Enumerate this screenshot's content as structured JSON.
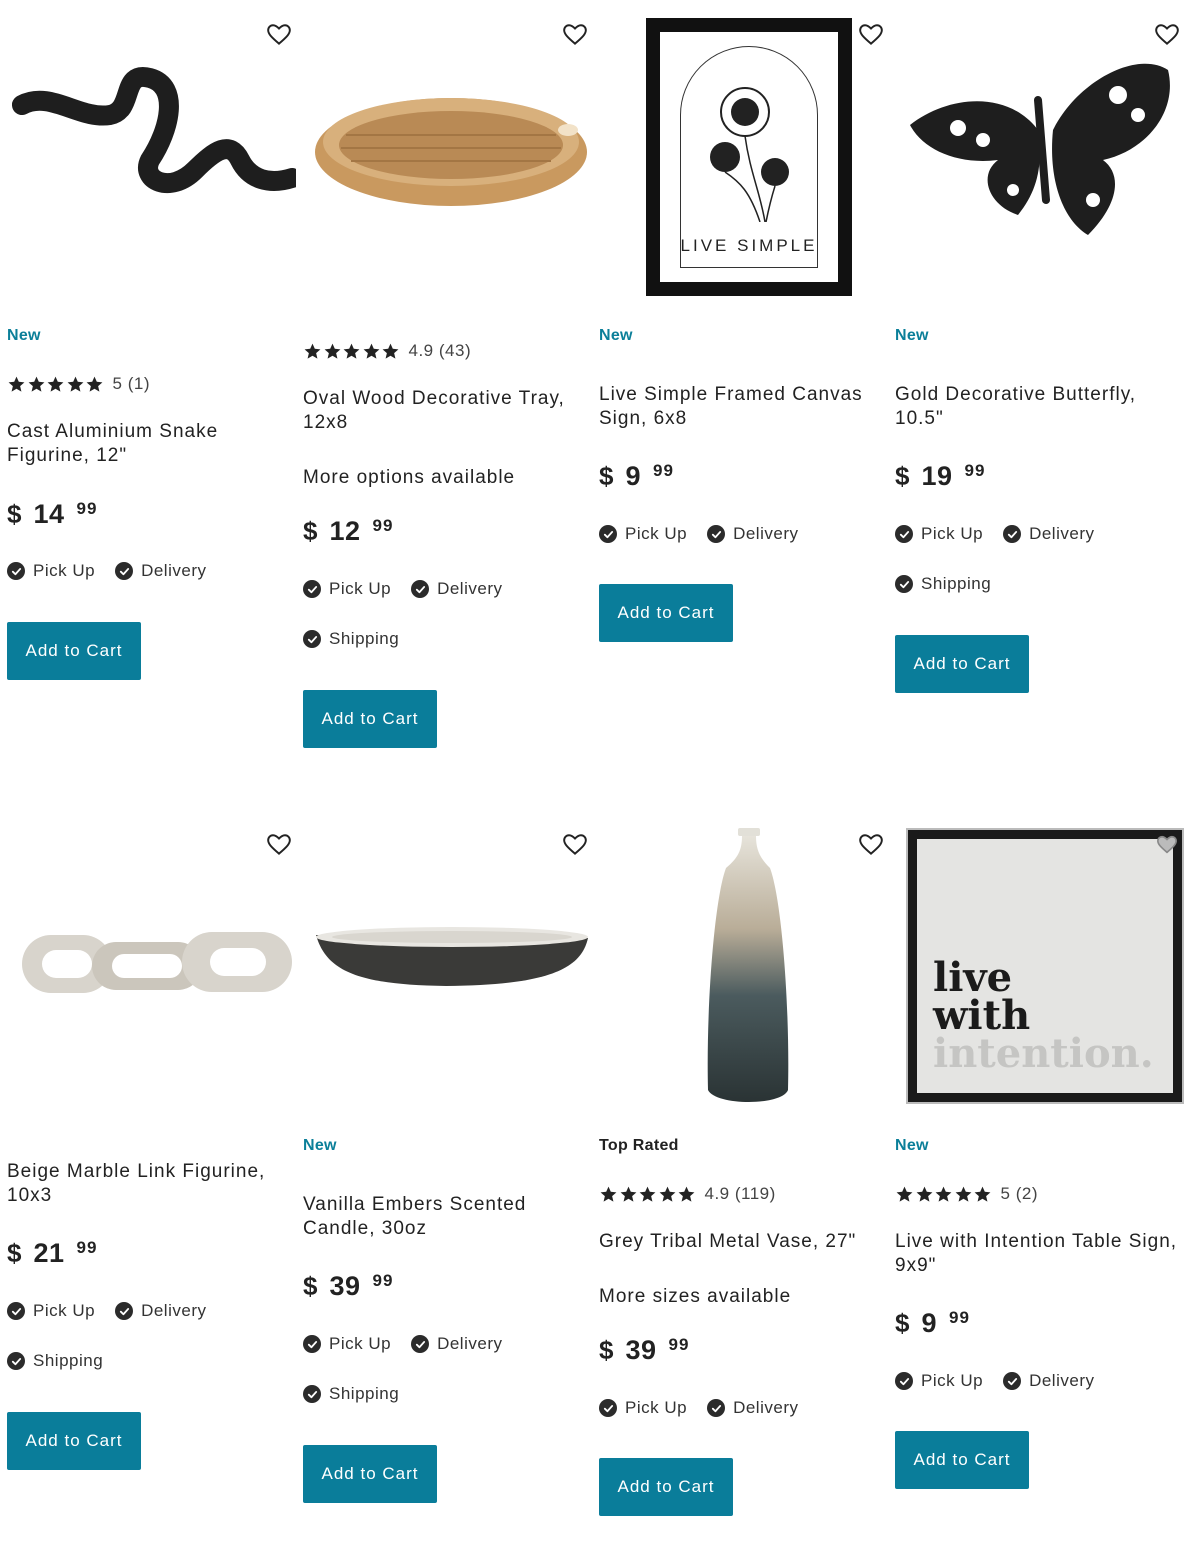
{
  "products": [
    {
      "badge": "New",
      "rating_value": "5",
      "rating_count": "(1)",
      "title_line1": "Cast Aluminium Snake",
      "title_line2": "Figurine, 12\"",
      "price_dollar": "$",
      "price_whole": "14",
      "price_cents": "99",
      "pickup": "Pick Up",
      "delivery": "Delivery",
      "button": "Add to Cart",
      "image_icon": "snake-figurine-icon"
    },
    {
      "rating_value": "4.9",
      "rating_count": "(43)",
      "title_line1": "Oval Wood Decorative Tray,",
      "title_line2": "12x8",
      "more": "More options available",
      "price_dollar": "$",
      "price_whole": "12",
      "price_cents": "99",
      "pickup": "Pick Up",
      "delivery": "Delivery",
      "shipping": "Shipping",
      "button": "Add to Cart",
      "image_icon": "wood-tray-icon"
    },
    {
      "badge": "New",
      "title_line1": "Live Simple Framed Canvas",
      "title_line2": "Sign, 6x8",
      "price_dollar": "$",
      "price_whole": "9",
      "price_cents": "99",
      "pickup": "Pick Up",
      "delivery": "Delivery",
      "button": "Add to Cart",
      "image_text": "LIVE SIMPLE",
      "image_icon": "framed-canvas-icon"
    },
    {
      "badge": "New",
      "title_line1": "Gold Decorative Butterfly,",
      "title_line2": "10.5\"",
      "price_dollar": "$",
      "price_whole": "19",
      "price_cents": "99",
      "pickup": "Pick Up",
      "delivery": "Delivery",
      "shipping": "Shipping",
      "button": "Add to Cart",
      "image_icon": "butterfly-icon"
    },
    {
      "title_line1": "Beige Marble Link Figurine,",
      "title_line2": "10x3",
      "price_dollar": "$",
      "price_whole": "21",
      "price_cents": "99",
      "pickup": "Pick Up",
      "delivery": "Delivery",
      "shipping": "Shipping",
      "button": "Add to Cart",
      "image_icon": "marble-link-icon"
    },
    {
      "badge": "New",
      "title_line1": "Vanilla Embers Scented",
      "title_line2": "Candle, 30oz",
      "price_dollar": "$",
      "price_whole": "39",
      "price_cents": "99",
      "pickup": "Pick Up",
      "delivery": "Delivery",
      "shipping": "Shipping",
      "button": "Add to Cart",
      "image_icon": "candle-bowl-icon"
    },
    {
      "badge": "Top Rated",
      "rating_value": "4.9",
      "rating_count": "(119)",
      "title_line1": "Grey Tribal Metal Vase, 27\"",
      "more": "More sizes available",
      "price_dollar": "$",
      "price_whole": "39",
      "price_cents": "99",
      "pickup": "Pick Up",
      "delivery": "Delivery",
      "button": "Add to Cart",
      "image_icon": "vase-icon"
    },
    {
      "badge": "New",
      "rating_value": "5",
      "rating_count": "(2)",
      "title_line1": "Live with Intention Table Sign,",
      "title_line2": "9x9\"",
      "price_dollar": "$",
      "price_whole": "9",
      "price_cents": "99",
      "pickup": "Pick Up",
      "delivery": "Delivery",
      "button": "Add to Cart",
      "image_text_1": "live",
      "image_text_2": "with",
      "image_text_3": "intention.",
      "image_icon": "table-sign-icon"
    }
  ],
  "colors": {
    "accent": "#0a7d9a",
    "badge": "#0b7f99",
    "text": "#222222"
  }
}
